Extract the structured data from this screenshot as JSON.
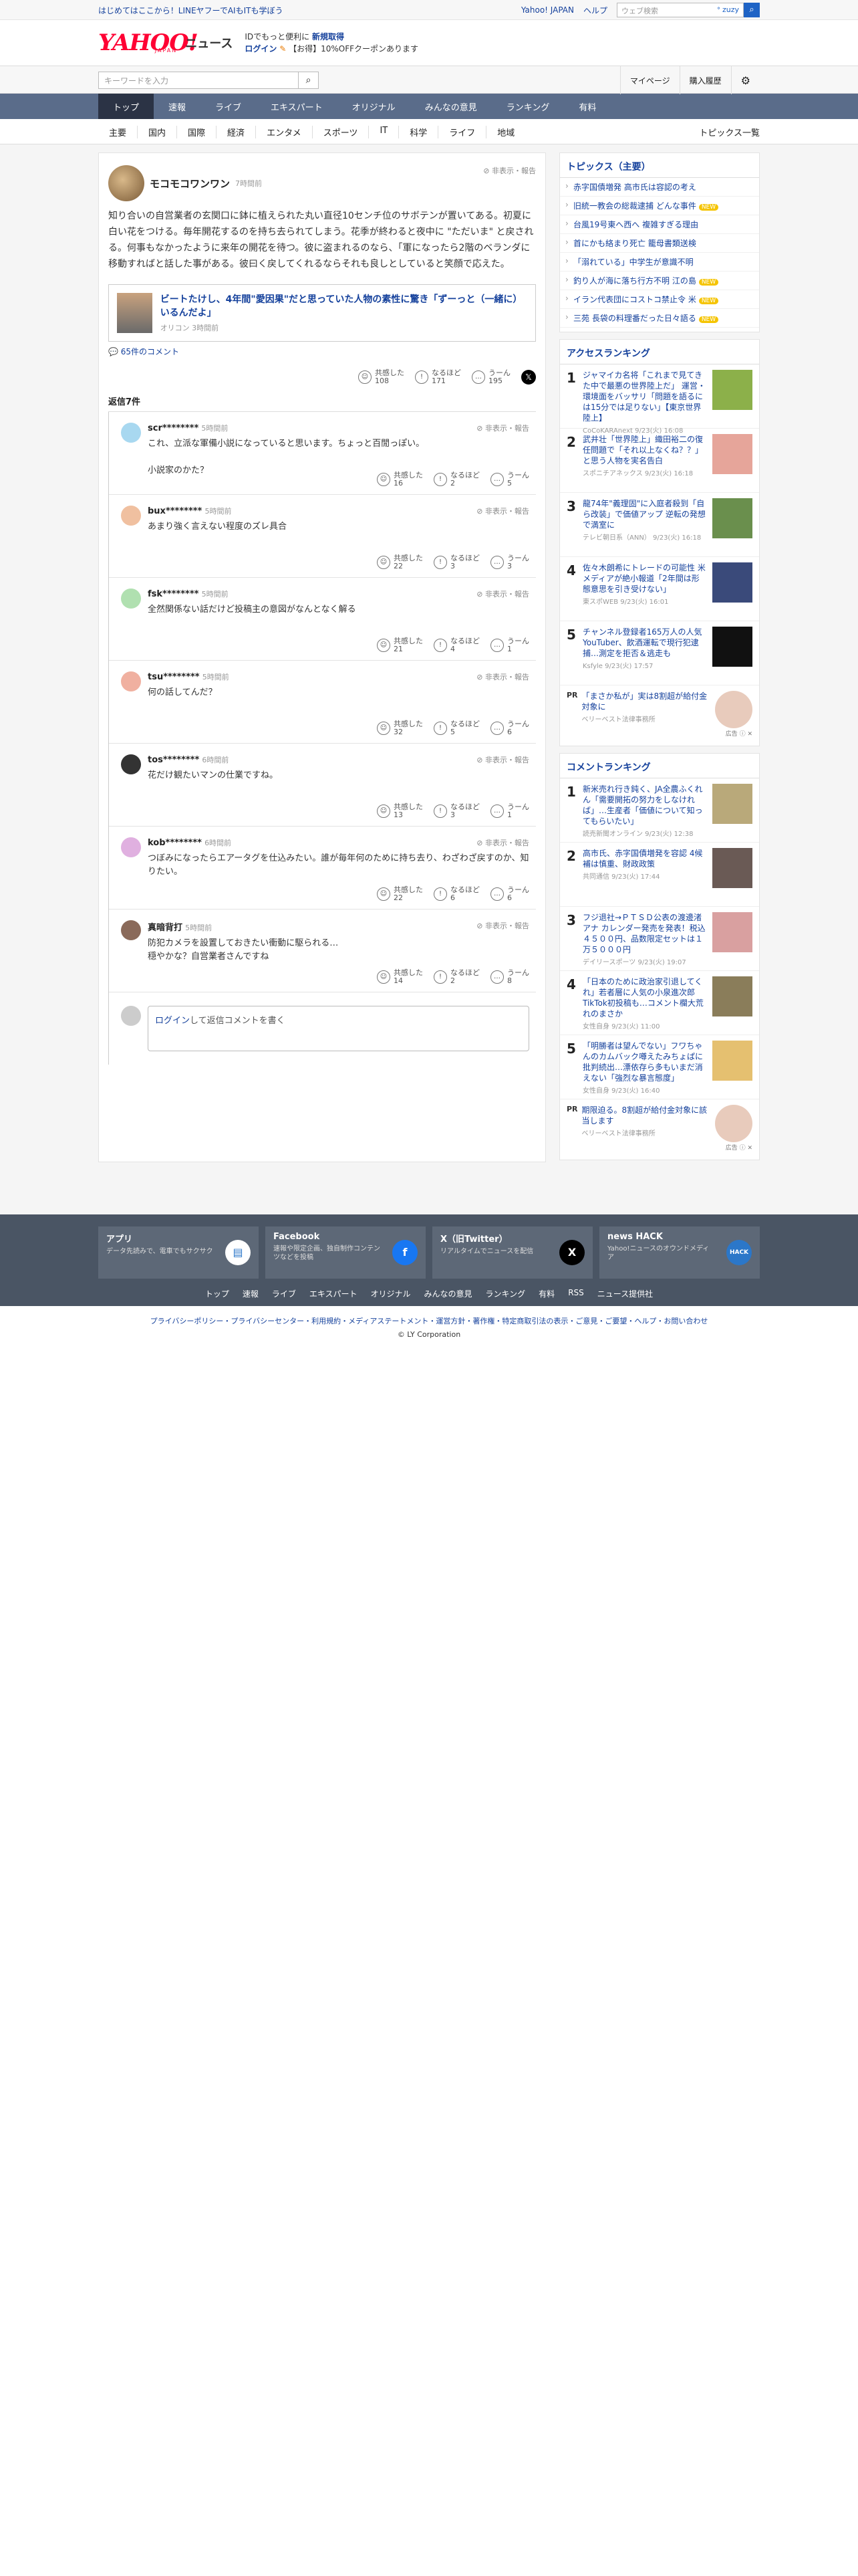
{
  "topbar": {
    "left_link": "はじめてはここから！LINEヤフーでAIもITも学ぼう",
    "yahoo_japan": "Yahoo! JAPAN",
    "help": "ヘルプ",
    "search_placeholder": "ウェブ検索",
    "zuzy": "ᐤ zuzy"
  },
  "header": {
    "logo_main": "YAHOO!",
    "logo_sub": "JAPAN",
    "logo_news": "ニュース",
    "promo_line1": "IDでもっと便利に",
    "promo_reg": "新規取得",
    "promo_login": "ログイン",
    "promo_line2": "【お得】10%OFFクーポンあります"
  },
  "searchrow": {
    "placeholder": "キーワードを入力",
    "mypage": "マイページ",
    "history": "購入履歴"
  },
  "nav": [
    "トップ",
    "速報",
    "ライブ",
    "エキスパート",
    "オリジナル",
    "みんなの意見",
    "ランキング",
    "有料"
  ],
  "subnav": [
    "主要",
    "国内",
    "国際",
    "経済",
    "エンタメ",
    "スポーツ",
    "IT",
    "科学",
    "ライフ",
    "地域"
  ],
  "subnav_all": "トピックス一覧",
  "comment": {
    "author": "モコモコワンワン",
    "time": "7時間前",
    "report": "非表示・報告",
    "body": "知り合いの自営業者の玄関口に鉢に植えられた丸い直径10センチ位のサボテンが置いてある。初夏に白い花をつける。毎年開花するのを持ち去られてしまう。花季が終わると夜中に \"ただいま\" と戻される。何事もなかったように来年の開花を待つ。彼に盗まれるのなら、「軍になったら2階のベランダに移動すればと話した事がある。彼曰く戻してくれるならそれも良しとしていると笑顔で応えた。",
    "article_title": "ビートたけし、4年間\"愛因果\"だと思っていた人物の素性に驚き「ずーっと（一緒に）いるんだよ」",
    "article_source": "オリコン 3時間前",
    "article_comments": "65件のコメント",
    "reactions": [
      {
        "label": "共感した",
        "count": "108"
      },
      {
        "label": "なるほど",
        "count": "171"
      },
      {
        "label": "うーん",
        "count": "195"
      }
    ]
  },
  "replies_title": "返信7件",
  "replies": [
    {
      "user": "scr********",
      "time": "5時間前",
      "text": "これ、立派な軍備小説になっていると思います。ちょっと百閒っぽい。\n\n小説家のかた？",
      "r": [
        "16",
        "2",
        "5"
      ]
    },
    {
      "user": "bux********",
      "time": "5時間前",
      "text": "あまり強く言えない程度のズレ具合",
      "r": [
        "22",
        "3",
        "3"
      ]
    },
    {
      "user": "fsk********",
      "time": "5時間前",
      "text": "全然関係ない話だけど投稿主の意図がなんとなく解る",
      "r": [
        "21",
        "4",
        "1"
      ]
    },
    {
      "user": "tsu********",
      "time": "5時間前",
      "text": "何の話してんだ？",
      "r": [
        "32",
        "5",
        "6"
      ]
    },
    {
      "user": "tos********",
      "time": "6時間前",
      "text": "花だけ観たいマンの仕業ですね。",
      "r": [
        "13",
        "3",
        "1"
      ]
    },
    {
      "user": "kob********",
      "time": "6時間前",
      "text": "つぼみになったらエアータグを仕込みたい。誰が毎年何のために持ち去り、わざわざ戻すのか、知りたい。",
      "r": [
        "22",
        "6",
        "6"
      ]
    },
    {
      "user": "真暗背打",
      "time": "5時間前",
      "text": "防犯カメラを設置しておきたい衝動に駆られる…\n穏やかな？自営業者さんですね",
      "r": [
        "14",
        "2",
        "8"
      ]
    }
  ],
  "reaction_labels": [
    "共感した",
    "なるほど",
    "うーん"
  ],
  "reply_login": "ログイン",
  "reply_prompt": "して返信コメントを書く",
  "topics": {
    "title": "トピックス（主要）",
    "items": [
      {
        "t": "赤字国債増発 高市氏は容認の考え",
        "b": ""
      },
      {
        "t": "旧統一教会の総裁逮捕 どんな事件",
        "b": "NEW"
      },
      {
        "t": "台風19号東へ西へ 複雑すぎる理由",
        "b": ""
      },
      {
        "t": "首にかも絡まり死亡 籠母書類送検",
        "b": ""
      },
      {
        "t": "「溺れている」中学生が意識不明",
        "b": ""
      },
      {
        "t": "釣り人が海に落ち行方不明 江の島",
        "b": "NEW"
      },
      {
        "t": "イラン代表団にコストコ禁止令 米",
        "b": "NEW"
      },
      {
        "t": "三苑 長袋の料理番だった日々語る",
        "b": "NEW"
      }
    ]
  },
  "access": {
    "title": "アクセスランキング",
    "items": [
      {
        "n": "1",
        "t": "ジャマイカ名将「これまで見てきた中で最悪の世界陸上だ」 運営・環境面をバッサリ「問題を語るには15分では足りない」【東京世界陸上】",
        "m": "CoCoKARAnext 9/23(火) 16:08",
        "c": "#8cb04a"
      },
      {
        "n": "2",
        "t": "武井壮「世界陸上」織田裕二の復任問題で「それ以上なくね？？」と思う人物を実名告白",
        "m": "スポニチアネックス 9/23(火) 16:18",
        "c": "#e6a59a"
      },
      {
        "n": "3",
        "t": "龍74年\"義理固\"に入庭者殺到「自ら改装」で価値アップ 逆転の発想で満室に",
        "m": "テレビ朝日系（ANN） 9/23(火) 16:18",
        "c": "#6a8f4d"
      },
      {
        "n": "4",
        "t": "佐々木朗希にトレードの可能性 米メディアが絶小報道「2年間は形態意思を引き受けない」",
        "m": "東スポWEB 9/23(火) 16:01",
        "c": "#3a4a7a"
      },
      {
        "n": "5",
        "t": "チャンネル登録者165万人の人気YouTuber、飲酒運転で現行犯逮捕…測定を拒否＆逃走も",
        "m": "Ksfyle 9/23(火) 17:57",
        "c": "#111"
      }
    ]
  },
  "pr1": {
    "tag": "PR",
    "t": "「まさか私が」実は8割超が給付金対象に",
    "m": "ベリーベスト法律事務所",
    "ad": "広告"
  },
  "comment_rank": {
    "title": "コメントランキング",
    "items": [
      {
        "n": "1",
        "t": "新米売れ行き鈍く、JA全農ふくれん「需要開拓の努力をしなければ」…生産者「価値について知ってもらいたい」",
        "m": "読売新聞オンライン 9/23(火) 12:38",
        "c": "#b9a97a"
      },
      {
        "n": "2",
        "t": "高市氏、赤字国債増発を容認 4候補は慎重、財政政策",
        "m": "共同通信 9/23(火) 17:44",
        "c": "#6a5a55"
      },
      {
        "n": "3",
        "t": "フジ退社→ＰＴＳＤ公表の渡邊渚アナ カレンダー発売を発表！税込４５００円、品数限定セットは１万５０００円",
        "m": "デイリースポーツ 9/23(火) 19:07",
        "c": "#d9a0a0"
      },
      {
        "n": "4",
        "t": "「日本のために政治家引退してくれ」若者層に人気の小泉進次郎 TikTok初投稿も…コメント欄大荒れのまさか",
        "m": "女性自身 9/23(火) 11:00",
        "c": "#8a7d5a"
      },
      {
        "n": "5",
        "t": "「明勝者は望んでない」フワちゃんのカムバック噂えたみちょぱに批判続出…漂依存ら多もいまだ消えない「強烈な暴言態度」",
        "m": "女性自身 9/23(火) 16:40",
        "c": "#e5c070"
      }
    ]
  },
  "pr2": {
    "tag": "PR",
    "t": "期限迫る。8割超が給付金対象に該当します",
    "m": "ベリーベスト法律事務所",
    "ad": "広告"
  },
  "footer": {
    "apps": [
      {
        "t": "アプリ",
        "d": "データ先読みで、電車でもサクサク",
        "i": "▤",
        "c": "#fff"
      },
      {
        "t": "Facebook",
        "d": "速報や限定企画、独自制作コンテンツなどを投稿",
        "i": "f",
        "c": "#1877f2"
      },
      {
        "t": "X（旧Twitter）",
        "d": "リアルタイムでニュースを配信",
        "i": "X",
        "c": "#000"
      },
      {
        "t": "news HACK",
        "d": "Yahoo!ニュースのオウンドメディア",
        "i": "HACK",
        "c": "#2b77c9"
      }
    ],
    "links": [
      "トップ",
      "速報",
      "ライブ",
      "エキスパート",
      "オリジナル",
      "みんなの意見",
      "ランキング",
      "有料",
      "RSS",
      "ニュース提供社"
    ],
    "legal": "プライバシーポリシー・プライバシーセンター・利用規約・メディアステートメント・運営方針・著作権・特定商取引法の表示・ご意見・ご要望・ヘルプ・お問い合わせ",
    "copyright": "© LY Corporation"
  },
  "colors": {
    "brand": "#ff0033",
    "link": "#15419c",
    "nav": "#5a6c8a"
  }
}
